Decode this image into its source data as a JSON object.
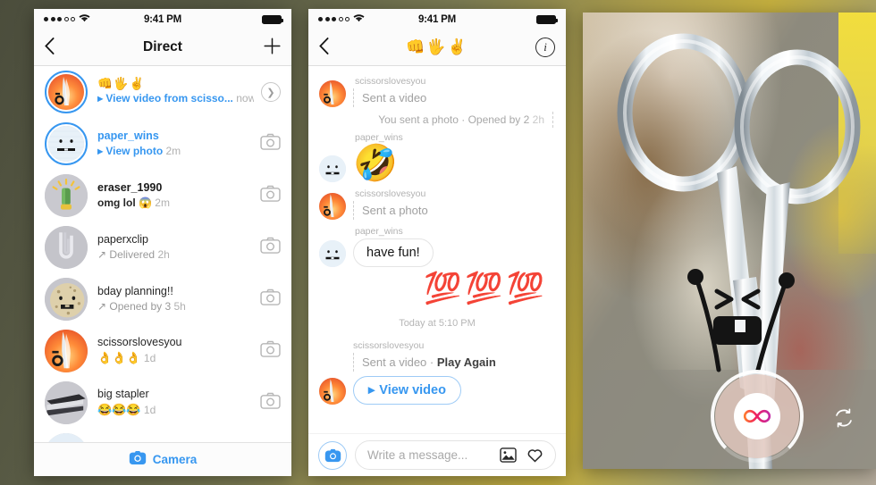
{
  "background": {
    "accent_olive": "#a89a4a",
    "accent_blue": "#3797f0"
  },
  "phone1": {
    "status_bar": {
      "time": "9:41 PM",
      "signal_dots": 5,
      "signal_filled": 3,
      "wifi_icon": "wifi-icon",
      "battery_icon": "battery-full-icon"
    },
    "nav": {
      "back_icon": "chevron-left-icon",
      "title": "Direct",
      "action_icon": "plus-icon"
    },
    "story_row": {
      "emojis": "👊🖐️✌️",
      "action": "View video from scisso...",
      "time": "now",
      "play_icon": "play-triangle-icon",
      "chevron_icon": "chevron-right-circle-icon",
      "avatar_name": "scissors-avatar"
    },
    "rows": [
      {
        "name": "paper_wins",
        "name_style": "unread-blue",
        "action": "View photo",
        "action_style": "blue",
        "prefix_icon": "play-triangle-icon",
        "time": "2m",
        "trailing_icon": "camera-icon",
        "avatar": "paper-face-avatar",
        "unread": true
      },
      {
        "name": "eraser_1990",
        "name_style": "bold",
        "action": "omg lol 😱",
        "action_style": "dark",
        "prefix_icon": "",
        "time": "2m",
        "trailing_icon": "camera-icon",
        "avatar": "eraser-avatar",
        "unread": false
      },
      {
        "name": "paperxclip",
        "name_style": "plain",
        "action": "Delivered",
        "action_style": "grey",
        "prefix_icon": "arrow-up-right-icon",
        "time": "2h",
        "trailing_icon": "camera-icon",
        "avatar": "paperclip-avatar",
        "unread": false
      },
      {
        "name": "bday planning!!",
        "name_style": "plain",
        "action": "Opened by 3",
        "action_style": "grey",
        "prefix_icon": "arrow-up-right-icon",
        "time": "5h",
        "trailing_icon": "camera-icon",
        "avatar": "cookie-avatar",
        "unread": false
      },
      {
        "name": "scissorslovesyou",
        "name_style": "plain",
        "action": "👌👌👌",
        "action_style": "emoji",
        "prefix_icon": "",
        "time": "1d",
        "trailing_icon": "camera-icon",
        "avatar": "scissors-avatar",
        "unread": false
      },
      {
        "name": "big stapler",
        "name_style": "plain",
        "action": "😂😂😂",
        "action_style": "emoji",
        "prefix_icon": "",
        "time": "1d",
        "trailing_icon": "camera-icon",
        "avatar": "stapler-avatar",
        "unread": false
      }
    ],
    "camera_tab": {
      "label": "Camera",
      "icon": "camera-icon"
    }
  },
  "phone2": {
    "status_bar": {
      "time": "9:41 PM",
      "signal_dots": 5,
      "signal_filled": 3,
      "wifi_icon": "wifi-icon",
      "battery_icon": "battery-full-icon"
    },
    "nav": {
      "back_icon": "chevron-left-icon",
      "title": "👊🖐️✌️",
      "action_icon": "info-circle-icon"
    },
    "messages": [
      {
        "type": "media-received",
        "username": "scissorslovesyou",
        "text": "Sent a video",
        "avatar": "scissors-avatar"
      },
      {
        "type": "status-sent",
        "text": "You sent a photo · Opened by 2",
        "time": "2h"
      },
      {
        "type": "emoji-received",
        "username": "paper_wins",
        "emoji": "🤣",
        "avatar": "paper-face-avatar"
      },
      {
        "type": "media-received",
        "username": "scissorslovesyou",
        "text": "Sent a photo",
        "avatar": "scissors-avatar"
      },
      {
        "type": "bubble-received",
        "username": "paper_wins",
        "text": "have fun!",
        "avatar": "paper-face-avatar"
      },
      {
        "type": "emoji-sent",
        "emoji": "💯💯💯"
      },
      {
        "type": "day-divider",
        "text": "Today at 5:10 PM"
      },
      {
        "type": "video-received",
        "username": "scissorslovesyou",
        "status_text": "Sent a video · ",
        "status_bold": "Play Again",
        "button_label": "View video",
        "play_icon": "play-triangle-icon",
        "avatar": "scissors-avatar"
      }
    ],
    "composer": {
      "camera_icon": "camera-icon",
      "placeholder": "Write a message...",
      "gallery_icon": "image-icon",
      "like_icon": "heart-icon"
    }
  },
  "phone3": {
    "photo_description": "scissors-photo",
    "shutter": {
      "icon": "infinity-boomerang-icon",
      "name": "shutter-button"
    },
    "flip_camera": {
      "icon": "flip-camera-icon"
    }
  }
}
